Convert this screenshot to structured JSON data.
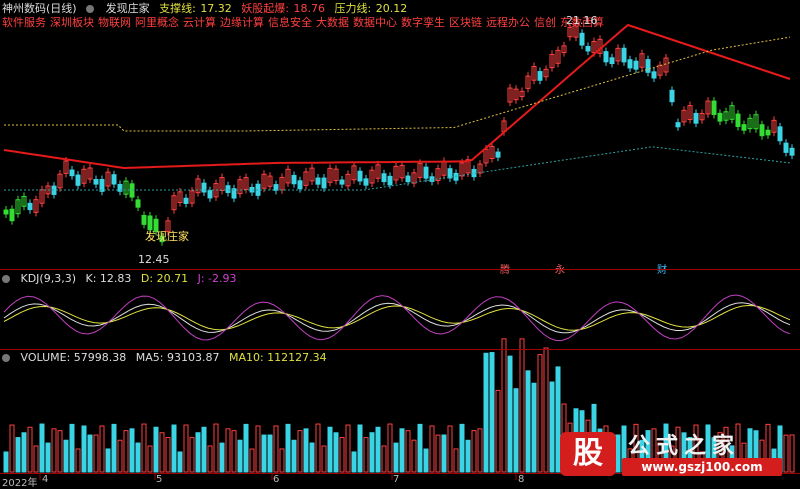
{
  "header": {
    "title": "神州数码(日线)",
    "indicator": "发现庄家",
    "support_label": "支撑线:",
    "support_value": "17.32",
    "demon_label": "妖股起爆:",
    "demon_value": "18.76",
    "pressure_label": "压力线:",
    "pressure_value": "20.12"
  },
  "concepts": [
    "软件服务",
    "深圳板块",
    "物联网",
    "阿里概念",
    "云计算",
    "边缘计算",
    "信息安全",
    "大数据",
    "数据中心",
    "数字孪生",
    "区块链",
    "远程办公",
    "信创",
    "东数西算"
  ],
  "main_chart": {
    "high_label": "21.16",
    "low_label": "12.45",
    "signal_label": "发现庄家",
    "markers": [
      "腾",
      "永",
      "财"
    ]
  },
  "kdj": {
    "name": "KDJ(9,3,3)",
    "k": "K: 12.83",
    "d": "D: 20.71",
    "j": "J: -2.93"
  },
  "volume": {
    "name": "VOLUME: 57998.38",
    "ma5": "MA5: 93103.87",
    "ma10": "MA10: 112127.34"
  },
  "xaxis": [
    "2022年",
    "4",
    "5",
    "6",
    "7",
    "8"
  ],
  "watermark": {
    "logo": "股",
    "title": "公式之家",
    "url": "www.gszj100.com"
  },
  "colors": {
    "up": "#ff4040",
    "down": "#3ad4e4",
    "signal": "#33dd33",
    "ma_red": "#e61a1a",
    "ma_yellow": "#e0c040",
    "ma_cyan": "#30a0a0"
  }
}
